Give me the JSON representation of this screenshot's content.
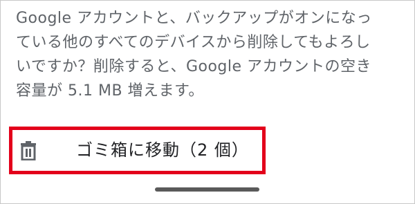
{
  "dialog": {
    "message_lines": [
      "Google アカウントと、バックアップがオンになっ",
      "ている他のすべてのデバイスから削除してもよろし",
      "いですか？削除すると、Google アカウントの空き",
      "容量が 5.1 MB 増えます。"
    ],
    "action": {
      "icon": "trash-icon",
      "label": "ゴミ箱に移動（2 個）"
    }
  },
  "colors": {
    "highlight_border": "#e3001b",
    "message_text": "#5f6368",
    "action_text": "#202124",
    "nav_pill": "#5a5a5a"
  }
}
